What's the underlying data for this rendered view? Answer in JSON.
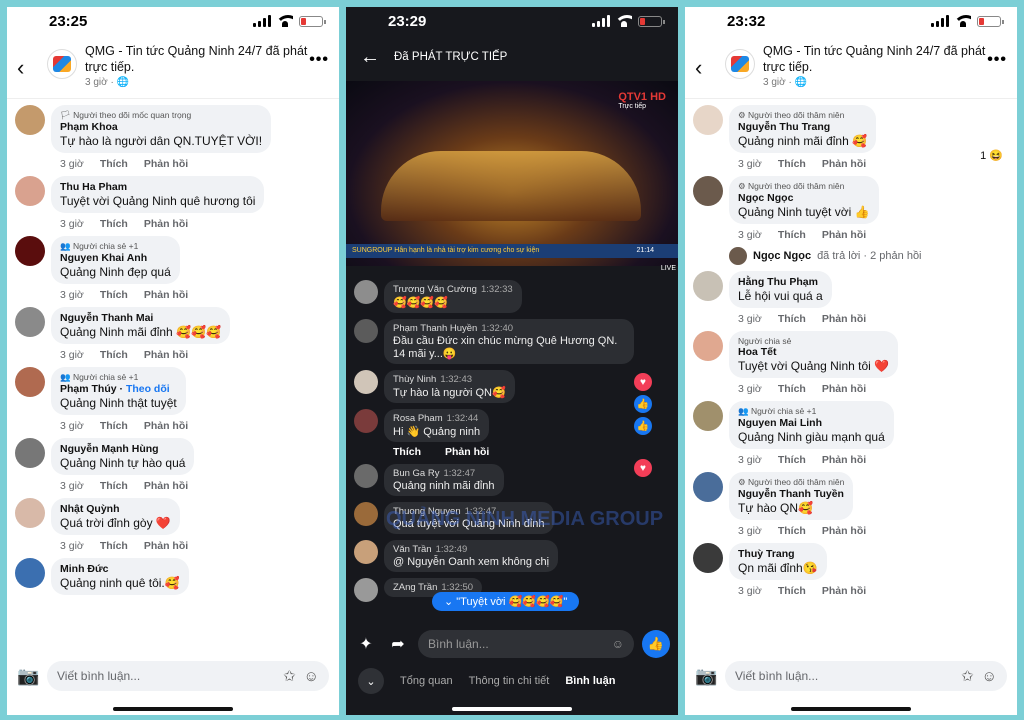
{
  "p1": {
    "time": "23:25",
    "header_title": "QMG - Tin tức Quảng Ninh 24/7 đã phát trực tiếp.",
    "header_sub": "3 giờ · 🌐",
    "comments": [
      {
        "tag": "🏳 Người theo dõi mốc quan trọng",
        "name": "Phạm Khoa",
        "text": "Tự hào là người dân QN.TUYỆT VỜI!",
        "time": "3 giờ",
        "like": "Thích",
        "reply": "Phản hồi",
        "color": "#c49a6c"
      },
      {
        "tag": "",
        "name": "Thu Ha Pham",
        "text": "Tuyệt vời Quảng Ninh quê hương tôi",
        "time": "3 giờ",
        "like": "Thích",
        "reply": "Phản hồi",
        "color": "#d9a28f"
      },
      {
        "tag": "👥 Người chia sẻ +1",
        "name": "Nguyen Khai Anh",
        "text": "Quảng Ninh đẹp quá",
        "time": "3 giờ",
        "like": "Thích",
        "reply": "Phản hồi",
        "color": "#5a0d0d"
      },
      {
        "tag": "",
        "name": "Nguyễn Thanh Mai",
        "text": "Quảng Ninh mãi đỉnh 🥰🥰🥰",
        "time": "3 giờ",
        "like": "Thích",
        "reply": "Phản hồi",
        "color": "#8a8a8a"
      },
      {
        "tag": "👥 Người chia sẻ +1",
        "name": "Phạm Thúy",
        "follow": "Theo dõi",
        "text": "Quảng Ninh thật tuyệt",
        "time": "3 giờ",
        "like": "Thích",
        "reply": "Phản hồi",
        "color": "#b06a50"
      },
      {
        "tag": "",
        "name": "Nguyễn Mạnh Hùng",
        "text": "Quảng Ninh tự hào quá",
        "time": "3 giờ",
        "like": "Thích",
        "reply": "Phản hồi",
        "color": "#777777"
      },
      {
        "tag": "",
        "name": "Nhật Quỳnh",
        "text": "Quá trời đỉnh gòy ❤️",
        "time": "3 giờ",
        "like": "Thích",
        "reply": "Phản hồi",
        "color": "#d8b9a8"
      },
      {
        "tag": "",
        "name": "Minh Đức",
        "text": "Quảng ninh quê tôi.🥰",
        "time": "",
        "like": "",
        "reply": "",
        "color": "#3b6fb0"
      }
    ],
    "input_placeholder": "Viết bình luận..."
  },
  "p2": {
    "time": "23:29",
    "title": "Đã PHÁT TRỰC TIẾP",
    "channel": "QTV1 HD",
    "channel_sub": "Trực tiếp",
    "ticker": "SUNGROUP  Hân hạnh là nhà tài trợ kim cương cho sự kiện",
    "ticker_time": "21:14",
    "live": "LIVE",
    "comments": [
      {
        "name": "Trương Văn Cường",
        "time": "1:32:33",
        "text": "🥰🥰🥰🥰"
      },
      {
        "name": "Phạm Thanh Huyền",
        "time": "1:32:40",
        "text": "Đầu cầu Đức xin chúc mừng Quê Hương QN. 14 mãi y...😛"
      },
      {
        "name": "Thùy Ninh",
        "time": "1:32:43",
        "text": "Tự hào là người QN🥰"
      },
      {
        "name": "Rosa Pham",
        "time": "1:32:44",
        "text": "Hi 👋 Quảng ninh",
        "like": "Thích",
        "reply": "Phản hồi"
      },
      {
        "name": "Bun Ga Ry",
        "time": "1:32:47",
        "text": "Quảng ninh mãi đỉnh"
      },
      {
        "name": "Thuong Nguyen",
        "time": "1:32:47",
        "text": "Quá tuyệt vời Quảng Ninh đỉnh"
      },
      {
        "name": "Văn Trần",
        "time": "1:32:49",
        "text": "@ Nguyễn Oanh xem không chị"
      },
      {
        "name": "ZAng Trần",
        "time": "1:32:50",
        "text": ""
      }
    ],
    "pill": "⌄ \"Tuyệt vời 🥰🥰🥰🥰\"",
    "watermark": "QUẢNG NINH MEDIA GROUP",
    "input_placeholder": "Bình luận...",
    "tabs": [
      "Tổng quan",
      "Thông tin chi tiết",
      "Bình luận"
    ]
  },
  "p3": {
    "time": "23:32",
    "header_title": "QMG - Tin tức Quảng Ninh 24/7 đã phát trực tiếp.",
    "header_sub": "3 giờ · 🌐",
    "comments": [
      {
        "tag": "⚙ Người theo dõi thâm niên",
        "name": "Nguyễn Thu Trang",
        "text": "Quảng ninh mãi đỉnh 🥰",
        "time": "3 giờ",
        "like": "Thích",
        "reply": "Phản hồi",
        "color": "#e7d6c8",
        "side": "1 😆"
      },
      {
        "tag": "⚙ Người theo dõi thâm niên",
        "name": "Ngọc Ngọc",
        "text": "Quảng Ninh tuyệt vời 👍",
        "time": "3 giờ",
        "like": "Thích",
        "reply": "Phản hồi",
        "color": "#6b5a4c"
      },
      {
        "tag": "",
        "name": "Hằng Thu Phạm",
        "text": "Lễ hội vui quá a",
        "time": "3 giờ",
        "like": "Thích",
        "reply": "Phản hồi",
        "color": "#c8c1b5"
      },
      {
        "tag": "Người chia sẻ",
        "name": "Hoa Tết",
        "text": "Tuyệt vời Quảng Ninh tôi ❤️",
        "time": "3 giờ",
        "like": "Thích",
        "reply": "Phản hồi",
        "color": "#e0a890"
      },
      {
        "tag": "👥 Người chia sẻ +1",
        "name": "Nguyen Mai Linh",
        "text": "Quảng Ninh giàu mạnh quá",
        "time": "3 giờ",
        "like": "Thích",
        "reply": "Phản hồi",
        "color": "#a0906c"
      },
      {
        "tag": "⚙ Người theo dõi thâm niên",
        "name": "Nguyễn Thanh Tuyền",
        "text": "Tự hào QN🥰",
        "time": "3 giờ",
        "like": "Thích",
        "reply": "Phản hồi",
        "color": "#4a6d9a"
      },
      {
        "tag": "",
        "name": "Thuỳ Trang",
        "text": "Qn mãi đỉnh😘",
        "time": "3 giờ",
        "like": "Thích",
        "reply": "Phản hồi",
        "color": "#3a3a3a"
      }
    ],
    "subreply": {
      "name": "Ngọc Ngọc",
      "rest": "đã trả lời · 2 phản hồi"
    },
    "input_placeholder": "Viết bình luận..."
  }
}
